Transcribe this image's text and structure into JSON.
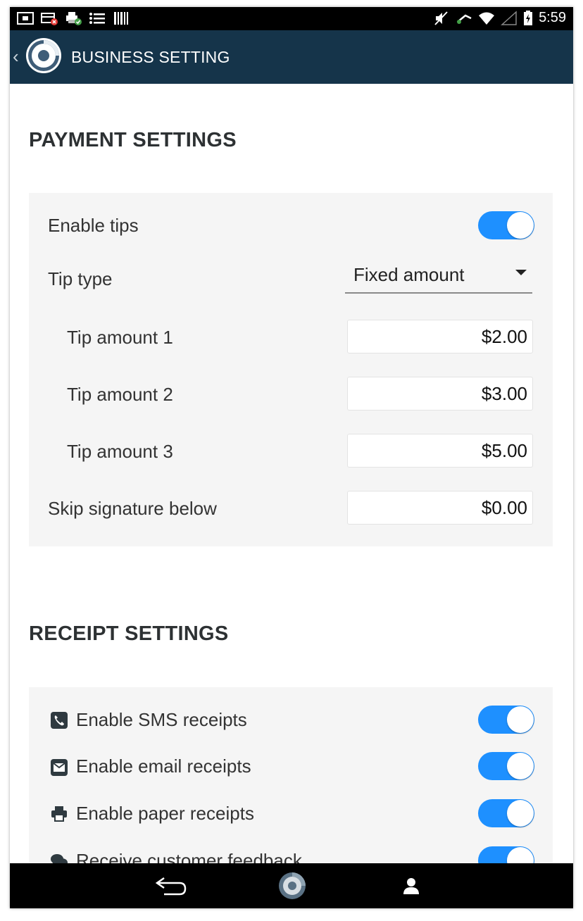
{
  "status_bar": {
    "time": "5:59",
    "left_icons": [
      "screen-icon",
      "sim-error-icon",
      "printer-ok-icon",
      "list-icon",
      "barcode-icon"
    ],
    "right_icons": [
      "mute-icon",
      "usb-icon",
      "wifi-icon",
      "signal-icon",
      "battery-charging-icon"
    ]
  },
  "app_bar": {
    "title": "BUSINESS SETTING",
    "back_icon": "chevron-left-icon",
    "logo_icon": "app-logo-icon"
  },
  "payment_settings": {
    "title": "PAYMENT SETTINGS",
    "enable_tips_label": "Enable tips",
    "enable_tips_on": true,
    "tip_type_label": "Tip type",
    "tip_type_value": "Fixed amount",
    "tip_amounts": [
      {
        "label": "Tip amount 1",
        "value": "$2.00"
      },
      {
        "label": "Tip amount 2",
        "value": "$3.00"
      },
      {
        "label": "Tip amount 3",
        "value": "$5.00"
      }
    ],
    "skip_signature_label": "Skip signature below",
    "skip_signature_value": "$0.00"
  },
  "receipt_settings": {
    "title": "RECEIPT SETTINGS",
    "items": [
      {
        "label": "Enable SMS receipts",
        "icon": "phone-icon",
        "on": true
      },
      {
        "label": "Enable email receipts",
        "icon": "envelope-icon",
        "on": true
      },
      {
        "label": "Enable paper receipts",
        "icon": "printer-icon",
        "on": true
      },
      {
        "label": "Receive customer feedback",
        "icon": "comments-icon",
        "on": true
      }
    ]
  },
  "nav_bar": {
    "icons": [
      "back-arrow-icon",
      "home-logo-icon",
      "person-icon"
    ]
  },
  "colors": {
    "app_bar": "#15344a",
    "toggle_on": "#1e90ff",
    "panel_bg": "#f5f5f5"
  }
}
